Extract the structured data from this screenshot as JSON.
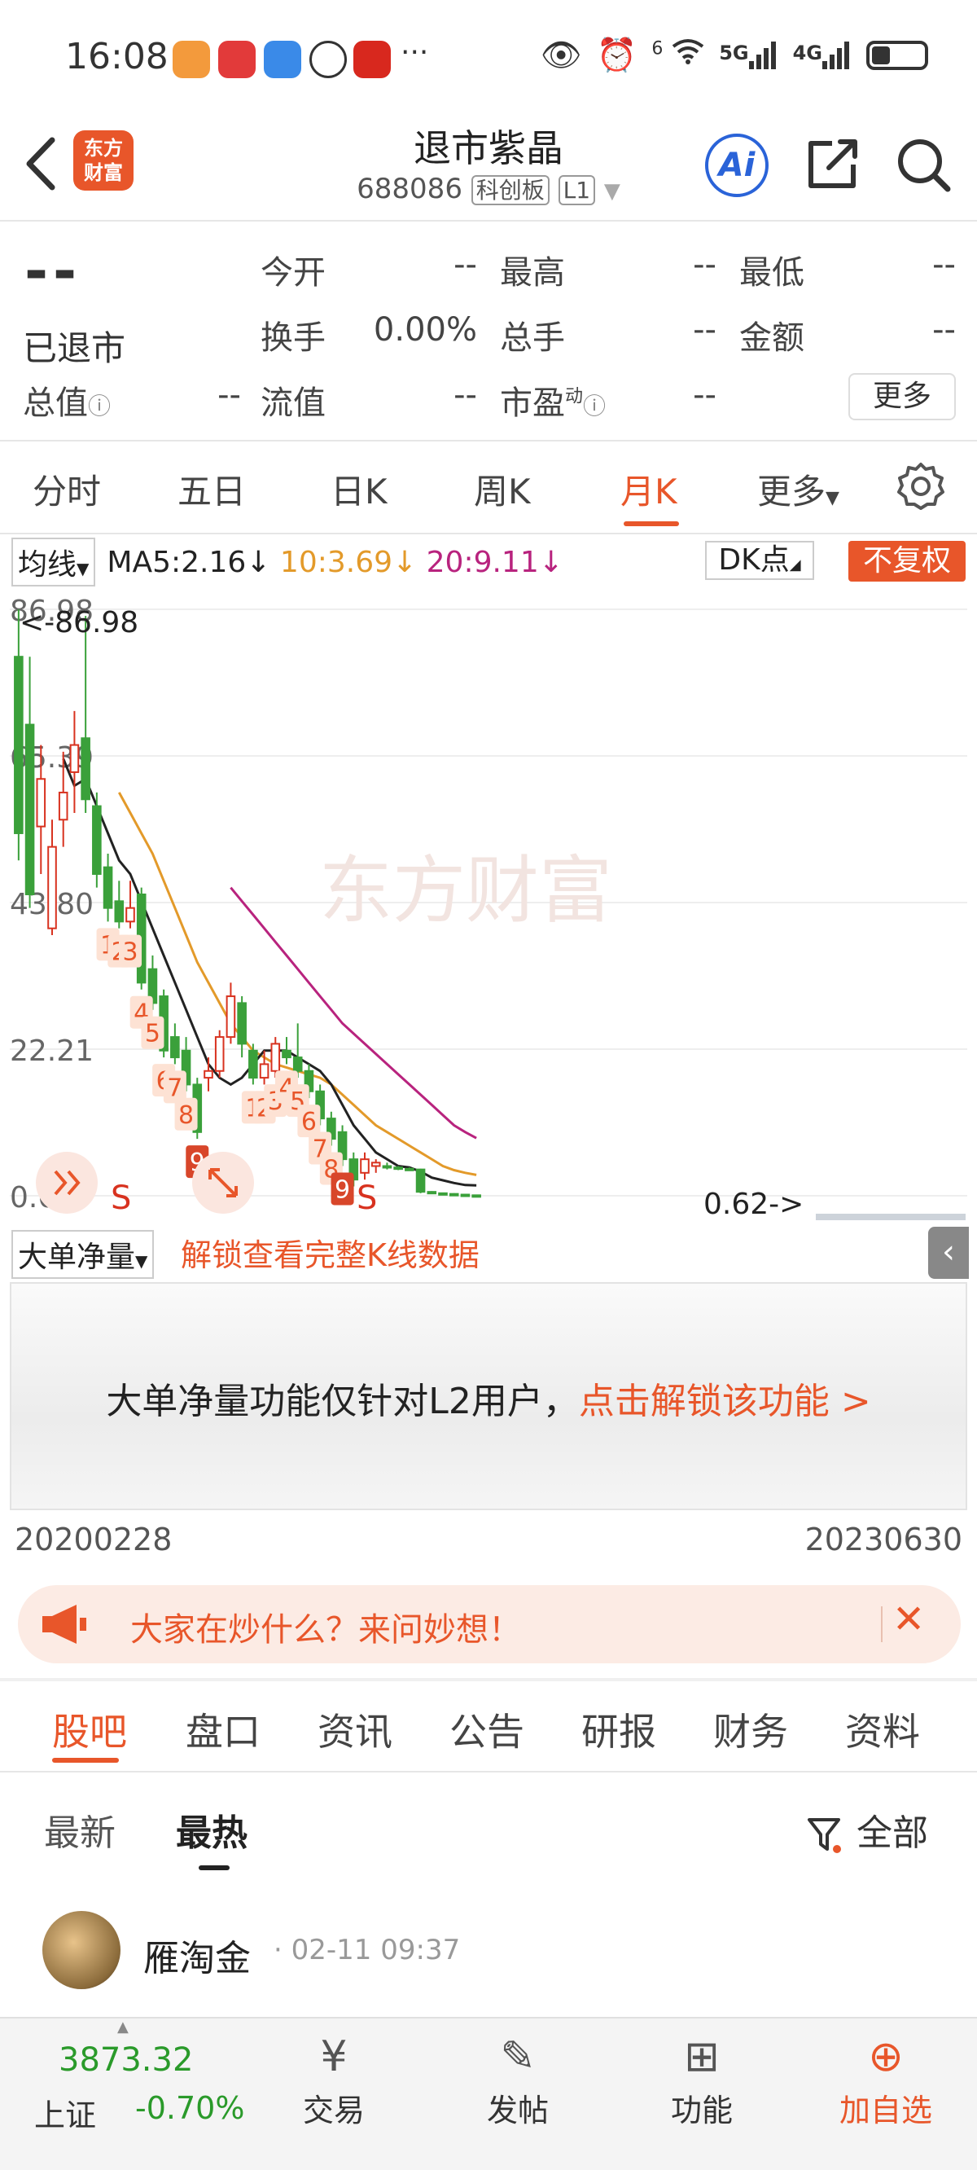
{
  "status_bar": {
    "time": "16:08",
    "more": "···",
    "net5g": "5G",
    "net4g": "4G",
    "wifi_num": "6"
  },
  "header": {
    "logo_line1": "东方",
    "logo_line2": "财富",
    "title": "退市紫晶",
    "code": "688086",
    "board": "科创板",
    "level": "L1",
    "ai": "Ai"
  },
  "quote": {
    "price": "--",
    "status": "已退市",
    "fields": [
      {
        "label": "今开",
        "value": "--"
      },
      {
        "label": "最高",
        "value": "--"
      },
      {
        "label": "最低",
        "value": "--"
      },
      {
        "label": "换手",
        "value": "0.00%"
      },
      {
        "label": "总手",
        "value": "--"
      },
      {
        "label": "金额",
        "value": "--"
      },
      {
        "label": "总值",
        "value": "--"
      },
      {
        "label": "流值",
        "value": "--"
      },
      {
        "label": "市盈",
        "value": "--"
      }
    ],
    "pe_sup": "动",
    "more_button": "更多"
  },
  "chart_tabs": [
    "分时",
    "五日",
    "日K",
    "周K",
    "月K",
    "更多"
  ],
  "ma_legend": {
    "selector": "均线",
    "ma5": "MA5:2.16",
    "ma10": "10:3.69",
    "ma20": "20:9.11",
    "dk": "DK点",
    "fuquan": "不复权",
    "colors": {
      "ma5": "#222222",
      "ma10": "#e39a2a",
      "ma20": "#b8237e",
      "up": "#d8321f",
      "down": "#3aa03a",
      "accent": "#e8562a"
    }
  },
  "chart_data": {
    "type": "candlestick",
    "y_ticks": [
      "86.98",
      "65.39",
      "43.80",
      "22.21",
      "0.62"
    ],
    "ylim": [
      0.62,
      86.98
    ],
    "max_label": "<-86.98",
    "min_label": "0.62->",
    "watermark": "东方财富",
    "sell_markers": [
      "S",
      "S"
    ],
    "start_date": "20200228",
    "end_date": "20230630",
    "candles": [
      {
        "o": 80,
        "c": 54,
        "h": 86.98,
        "l": 50
      },
      {
        "o": 70,
        "c": 45,
        "h": 80,
        "l": 43
      },
      {
        "o": 55,
        "c": 62,
        "h": 67,
        "l": 48
      },
      {
        "o": 40,
        "c": 52,
        "h": 56,
        "l": 39
      },
      {
        "o": 56,
        "c": 60,
        "h": 66,
        "l": 52
      },
      {
        "o": 63,
        "c": 67,
        "h": 72,
        "l": 57
      },
      {
        "o": 68,
        "c": 59,
        "h": 86,
        "l": 57
      },
      {
        "o": 58,
        "c": 48,
        "h": 60,
        "l": 46
      },
      {
        "o": 49,
        "c": 43,
        "h": 51,
        "l": 41
      },
      {
        "o": 44,
        "c": 41,
        "h": 47,
        "l": 40
      },
      {
        "o": 41,
        "c": 43,
        "h": 47,
        "l": 40
      },
      {
        "o": 45,
        "c": 32,
        "h": 46,
        "l": 31
      },
      {
        "o": 34,
        "c": 29,
        "h": 36,
        "l": 28
      },
      {
        "o": 30,
        "c": 22,
        "h": 31,
        "l": 21
      },
      {
        "o": 24,
        "c": 21,
        "h": 26,
        "l": 20
      },
      {
        "o": 22,
        "c": 17,
        "h": 24,
        "l": 16
      },
      {
        "o": 17,
        "c": 10,
        "h": 18,
        "l": 9
      },
      {
        "o": 18,
        "c": 19,
        "h": 21,
        "l": 16
      },
      {
        "o": 19,
        "c": 24,
        "h": 25,
        "l": 18
      },
      {
        "o": 24,
        "c": 30,
        "h": 32,
        "l": 23
      },
      {
        "o": 29,
        "c": 23,
        "h": 30,
        "l": 21
      },
      {
        "o": 22,
        "c": 18,
        "h": 23,
        "l": 17
      },
      {
        "o": 18,
        "c": 20,
        "h": 22,
        "l": 17
      },
      {
        "o": 19,
        "c": 23,
        "h": 24,
        "l": 18
      },
      {
        "o": 22,
        "c": 21,
        "h": 24,
        "l": 20
      },
      {
        "o": 21,
        "c": 19,
        "h": 26,
        "l": 18
      },
      {
        "o": 19,
        "c": 16,
        "h": 20,
        "l": 15
      },
      {
        "o": 16,
        "c": 12,
        "h": 17,
        "l": 11
      },
      {
        "o": 12,
        "c": 9,
        "h": 13,
        "l": 8
      },
      {
        "o": 10,
        "c": 6,
        "h": 11,
        "l": 5
      },
      {
        "o": 6,
        "c": 3,
        "h": 7,
        "l": 2
      },
      {
        "o": 4,
        "c": 6,
        "h": 7,
        "l": 3
      },
      {
        "o": 5,
        "c": 5.5,
        "h": 6,
        "l": 4
      },
      {
        "o": 5,
        "c": 4.8,
        "h": 5.5,
        "l": 4.5
      },
      {
        "o": 4.8,
        "c": 4.6,
        "h": 5,
        "l": 4.4
      },
      {
        "o": 4.6,
        "c": 4.5,
        "h": 4.8,
        "l": 4.3
      },
      {
        "o": 4.5,
        "c": 1.2,
        "h": 4.6,
        "l": 1
      },
      {
        "o": 1.2,
        "c": 1,
        "h": 1.3,
        "l": 0.9
      },
      {
        "o": 1,
        "c": 0.9,
        "h": 1.1,
        "l": 0.8
      },
      {
        "o": 0.9,
        "c": 0.8,
        "h": 1,
        "l": 0.7
      },
      {
        "o": 0.8,
        "c": 0.7,
        "h": 0.9,
        "l": 0.65
      },
      {
        "o": 0.7,
        "c": 0.62,
        "h": 0.75,
        "l": 0.62
      }
    ],
    "ma5": [
      null,
      null,
      null,
      null,
      65,
      61,
      62,
      58,
      54,
      50,
      48,
      44,
      40,
      36,
      32,
      28,
      24,
      20,
      18,
      17,
      18,
      20,
      22,
      22,
      22,
      21,
      20,
      19,
      17,
      14,
      11,
      9,
      7,
      6,
      5,
      4.8,
      4.2,
      3.3,
      2.9,
      2.5,
      2.2,
      2.16
    ],
    "ma10": [
      null,
      null,
      null,
      null,
      null,
      null,
      null,
      null,
      null,
      60,
      57,
      54,
      51,
      47,
      43,
      39,
      35,
      32,
      29,
      26,
      24,
      22,
      21,
      20,
      19.5,
      19,
      18.5,
      18,
      17,
      15.5,
      14,
      12.5,
      11,
      10,
      9,
      8,
      7,
      6,
      5,
      4.4,
      4,
      3.69
    ],
    "ma20": [
      null,
      null,
      null,
      null,
      null,
      null,
      null,
      null,
      null,
      null,
      null,
      null,
      null,
      null,
      null,
      null,
      null,
      null,
      null,
      46,
      44,
      42,
      40,
      38,
      36,
      34,
      32,
      30,
      28,
      26,
      24.5,
      23,
      21.5,
      20,
      18.5,
      17,
      15.5,
      14,
      12.5,
      11,
      10,
      9.11
    ],
    "counter_labels": [
      {
        "i": 8,
        "t": "1",
        "low": false
      },
      {
        "i": 9,
        "t": "2",
        "low": false
      },
      {
        "i": 10,
        "t": "3",
        "low": false
      },
      {
        "i": 11,
        "t": "4",
        "low": false
      },
      {
        "i": 12,
        "t": "5",
        "low": false
      },
      {
        "i": 13,
        "t": "6",
        "low": false
      },
      {
        "i": 14,
        "t": "7",
        "low": false
      },
      {
        "i": 15,
        "t": "8",
        "low": false
      },
      {
        "i": 16,
        "t": "9",
        "low": true
      },
      {
        "i": 21,
        "t": "1",
        "low": false
      },
      {
        "i": 22,
        "t": "2",
        "low": false
      },
      {
        "i": 23,
        "t": "3",
        "low": false
      },
      {
        "i": 24,
        "t": "4",
        "low": false
      },
      {
        "i": 25,
        "t": "5",
        "low": false
      },
      {
        "i": 26,
        "t": "6",
        "low": false
      },
      {
        "i": 27,
        "t": "7",
        "low": false
      },
      {
        "i": 28,
        "t": "8",
        "low": false
      },
      {
        "i": 29,
        "t": "9",
        "low": true
      }
    ]
  },
  "volume_panel": {
    "selector": "大单净量",
    "unlock_hint": "解锁查看完整K线数据",
    "message": "大单净量功能仅针对L2用户，",
    "message_link": "点击解锁该功能 >"
  },
  "dates": {
    "start": "20200228",
    "end": "20230630"
  },
  "banner": {
    "text": "大家在炒什么？来问妙想！"
  },
  "info_tabs": [
    "股吧",
    "盘口",
    "资讯",
    "公告",
    "研报",
    "财务",
    "资料"
  ],
  "sort_tabs": {
    "latest": "最新",
    "hot": "最热",
    "filter": "全部"
  },
  "post": {
    "user": "雁淘金",
    "time": "· 02-11 09:37"
  },
  "bottom_nav": {
    "index_value": "3873.32",
    "index_name": "上证",
    "index_change": "-0.70%",
    "items": [
      {
        "label": "交易",
        "icon": "¥"
      },
      {
        "label": "发帖",
        "icon": "✎"
      },
      {
        "label": "功能",
        "icon": "⊞"
      },
      {
        "label": "加自选",
        "icon": "⊕"
      }
    ]
  }
}
